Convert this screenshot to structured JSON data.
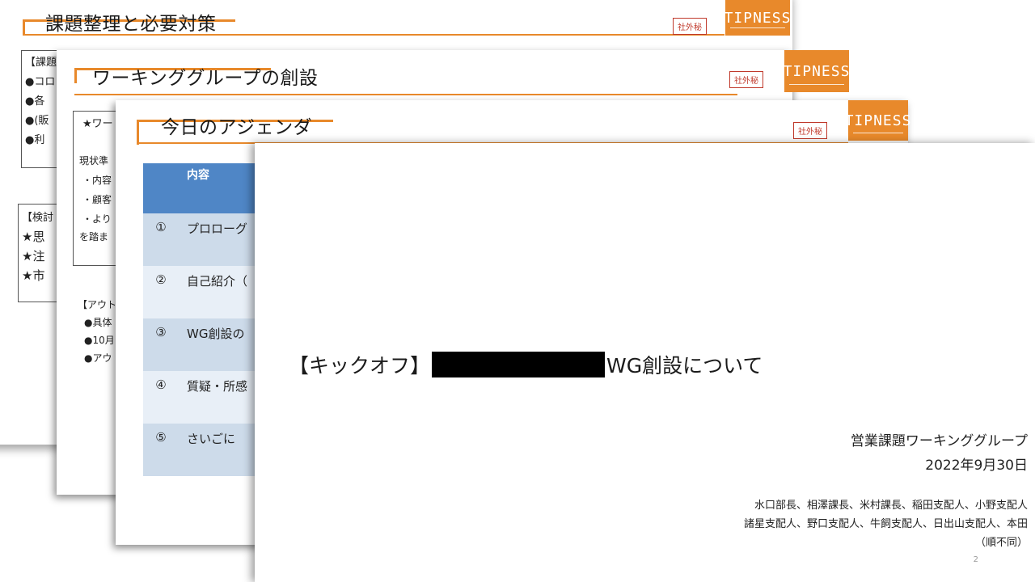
{
  "slides": {
    "s1": {
      "title": "課題整理と必要対策",
      "badge": "社外秘",
      "logo": "TIPNESS",
      "fragments": [
        "【課題",
        "●コロ",
        "●各",
        "●(販",
        "●利",
        "【検討",
        "★思",
        "★注",
        "★市"
      ]
    },
    "s2": {
      "title": "ワーキンググループの創設",
      "badge": "社外秘",
      "logo": "TIPNESS",
      "fragments": [
        "★ワー",
        "現状準",
        "・内容",
        "・顧客",
        "・より",
        "を踏ま",
        "【アウト",
        "●具体",
        "●10月",
        "●アウ"
      ]
    },
    "s3": {
      "title": "今日のアジェンダ",
      "badge": "社外秘",
      "logo": "TIPNESS",
      "table_header": "内容",
      "rows": [
        {
          "num": "①",
          "text": "プロローグ"
        },
        {
          "num": "②",
          "text": "自己紹介（"
        },
        {
          "num": "③",
          "text": "WG創設の"
        },
        {
          "num": "④",
          "text": "質疑・所感"
        },
        {
          "num": "⑤",
          "text": "さいごに"
        }
      ]
    },
    "s4": {
      "title_prefix": "【キックオフ】",
      "title_suffix": "WG創設について",
      "org": "営業課題ワーキンググループ",
      "date": "2022年9月30日",
      "members_line1": "水口部長、相澤課長、米村課長、稲田支配人、小野支配人",
      "members_line2": "諸星支配人、野口支配人、牛飼支配人、日出山支配人、本田",
      "note": "（順不同）",
      "page_number": "2"
    }
  },
  "colors": {
    "accent": "#e8892b",
    "table_header": "#4f86c6",
    "badge": "#c0392b"
  }
}
